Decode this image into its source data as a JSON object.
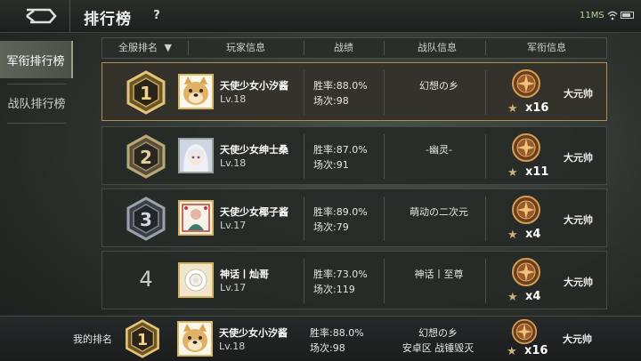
{
  "topbar": {
    "title": "排行榜",
    "help": "?",
    "ping": "11MS"
  },
  "sidebar": {
    "items": [
      {
        "label": "军衔排行榜",
        "active": true
      },
      {
        "label": "战队排行榜",
        "active": false
      }
    ]
  },
  "table": {
    "headers": {
      "rank": "全服排名",
      "rank_sort_icon": "▼",
      "player": "玩家信息",
      "record": "战绩",
      "team": "战队信息",
      "rank_info": "军衔信息"
    },
    "rows": [
      {
        "rank": "1",
        "name": "天使少女小汐酱",
        "level": "Lv.18",
        "winrate": "胜率:88.0%",
        "games": "场次:98",
        "team": "幻想の乡",
        "medal_count": "x16",
        "title": "大元帅",
        "avatar": "doge-avatar"
      },
      {
        "rank": "2",
        "name": "天使少女绅士桑",
        "level": "Lv.18",
        "winrate": "胜率:87.0%",
        "games": "场次:91",
        "team": "-幽灵-",
        "medal_count": "x11",
        "title": "大元帅",
        "avatar": "anime-girl-avatar"
      },
      {
        "rank": "3",
        "name": "天使少女椰子酱",
        "level": "Lv.17",
        "winrate": "胜率:89.0%",
        "games": "场次:79",
        "team": "萌动の二次元",
        "medal_count": "x4",
        "title": "大元帅",
        "avatar": "card-avatar"
      },
      {
        "rank": "4",
        "name": "神话丨灿哥",
        "level": "Lv.17",
        "winrate": "胜率:73.0%",
        "games": "场次:119",
        "team": "神话丨至尊",
        "medal_count": "x4",
        "title": "大元帅",
        "avatar": "rose-avatar"
      }
    ]
  },
  "my_rank": {
    "label": "我的排名",
    "rank": "1",
    "name": "天使少女小汐酱",
    "level": "Lv.18",
    "winrate": "胜率:88.0%",
    "games": "场次:98",
    "team": "幻想の乡",
    "team_sub": "安卓区 战锤毁灭",
    "medal_count": "x16",
    "title": "大元帅"
  },
  "colors": {
    "highlight_border": "#b08e52",
    "gold": "#d9b766",
    "background": "#2b302c"
  }
}
